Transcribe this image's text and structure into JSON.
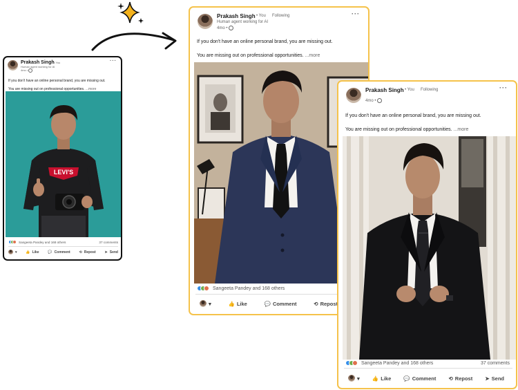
{
  "post": {
    "author": "Prakash Singh",
    "degree": "• You",
    "following": "Following",
    "headline": "Human agent working for AI",
    "time": "4mo •",
    "line1": "If you don't have an online personal brand, you are missing out.",
    "line2": "You are missing out on professional opportunities.",
    "more": "...more",
    "reactions_text": "Sangeeta Pandey and 168 others",
    "comments": "37 comments",
    "actions": {
      "like": "Like",
      "comment": "Comment",
      "repost": "Repost",
      "send": "Send"
    }
  },
  "icons": [
    "sparkle-icon",
    "arrow-icon",
    "globe-icon",
    "like-icon",
    "comment-icon",
    "repost-icon",
    "send-icon",
    "chevron-down-icon"
  ],
  "colors": {
    "highlight_border": "#f5c24a",
    "original_border": "#111111",
    "photo1_bg": "#2b9c99",
    "like_blue": "#378fe9",
    "love_red": "#df704d"
  }
}
